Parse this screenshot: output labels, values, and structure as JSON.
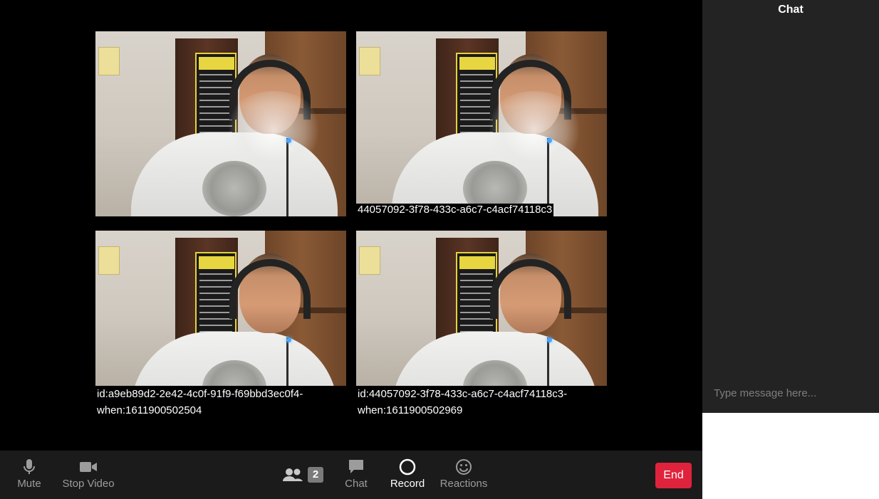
{
  "video_tiles": [
    {
      "id": "tile-1",
      "caption": ""
    },
    {
      "id": "tile-2",
      "caption": "44057092-3f78-433c-a6c7-c4acf74118c3"
    },
    {
      "id": "tile-3",
      "caption_line1": "id:a9eb89d2-2e42-4c0f-91f9-f69bbd3ec0f4-",
      "caption_line2": "when:1611900502504"
    },
    {
      "id": "tile-4",
      "caption_line1": "id:44057092-3f78-433c-a6c7-c4acf74118c3-",
      "caption_line2": "when:1611900502969"
    }
  ],
  "toolbar": {
    "mute_label": "Mute",
    "stop_video_label": "Stop Video",
    "participants_count": "2",
    "chat_label": "Chat",
    "record_label": "Record",
    "reactions_label": "Reactions",
    "end_label": "End"
  },
  "chat": {
    "title": "Chat",
    "placeholder": "Type message here..."
  },
  "colors": {
    "end_button": "#e0233c",
    "toolbar_bg": "#1b1b1b",
    "chat_bg": "#232323"
  },
  "icons": {
    "mute": "microphone-icon",
    "stop_video": "video-camera-icon",
    "participants": "participants-icon",
    "chat": "chat-bubble-icon",
    "record": "record-circle-icon",
    "reactions": "smiley-icon"
  }
}
